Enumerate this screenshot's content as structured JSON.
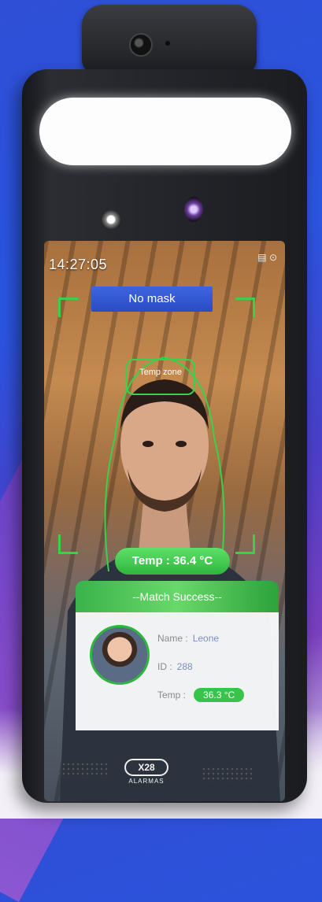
{
  "status_bar": {
    "time": "14:27:05",
    "icons": [
      "sd-card-icon",
      "settings-icon"
    ]
  },
  "mask_status": "No mask",
  "temp_zone_label": "Temp zone",
  "temperature_reading": "Temp : 36.4 °C",
  "match": {
    "header": "--Match Success--",
    "name_label": "Name :",
    "name_value": "Leone",
    "id_label": "ID :",
    "id_value": "288",
    "temp_label": "Temp :",
    "temp_value": "36.3 °C"
  },
  "branding": {
    "logo": "X28",
    "subtitle": "ALARMAS"
  },
  "colors": {
    "accent_green": "#38d14c",
    "mask_blue": "#2a4cc4",
    "led": "#ffffff"
  }
}
